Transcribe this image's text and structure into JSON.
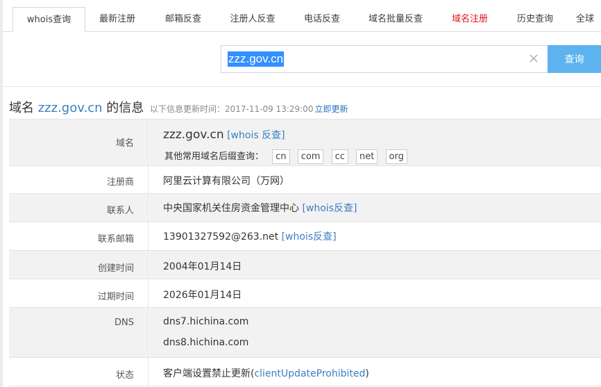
{
  "tabs": [
    {
      "label": "whois查询",
      "active": true
    },
    {
      "label": "最新注册"
    },
    {
      "label": "邮箱反查"
    },
    {
      "label": "注册人反查"
    },
    {
      "label": "电话反查"
    },
    {
      "label": "域名批量反查"
    },
    {
      "label": "域名注册",
      "color": "#e0121b"
    },
    {
      "label": "历史查询"
    },
    {
      "label": "全球"
    }
  ],
  "search": {
    "value": "zzz.gov.cn",
    "button_label": "查询",
    "button_color": "#5db3ef"
  },
  "heading": {
    "prefix": "域名",
    "domain": "zzz.gov.cn",
    "suffix": "的信息",
    "update_text": "以下信息更新时间：2017-11-09 13:29:00",
    "refresh_label": "立即更新"
  },
  "info": {
    "domain": {
      "label": "域名",
      "value": "zzz.gov.cn",
      "link": "[whois 反查]",
      "suffix_prompt": "其他常用域名后缀查询：",
      "suffixes": [
        "cn",
        "com",
        "cc",
        "net",
        "org"
      ]
    },
    "registrar": {
      "label": "注册商",
      "value": "阿里云计算有限公司（万网）"
    },
    "contact": {
      "label": "联系人",
      "value": "中央国家机关住房资金管理中心",
      "link": "[whois反查]"
    },
    "email": {
      "label": "联系邮箱",
      "value": "13901327592@263.net",
      "link": "[whois反查]"
    },
    "created": {
      "label": "创建时间",
      "value": "2004年01月14日"
    },
    "expires": {
      "label": "过期时间",
      "value": "2026年01月14日"
    },
    "dns": {
      "label": "DNS",
      "values": [
        "dns7.hichina.com",
        "dns8.hichina.com"
      ]
    },
    "status": {
      "label": "状态",
      "value_cn": "客户端设置禁止更新(",
      "value_code": "clientUpdateProhibited",
      "value_end": ")"
    }
  },
  "colors": {
    "link": "#3b7fc4",
    "accent_red": "#e0121b",
    "row_alt_bg": "#f2f2f2"
  }
}
